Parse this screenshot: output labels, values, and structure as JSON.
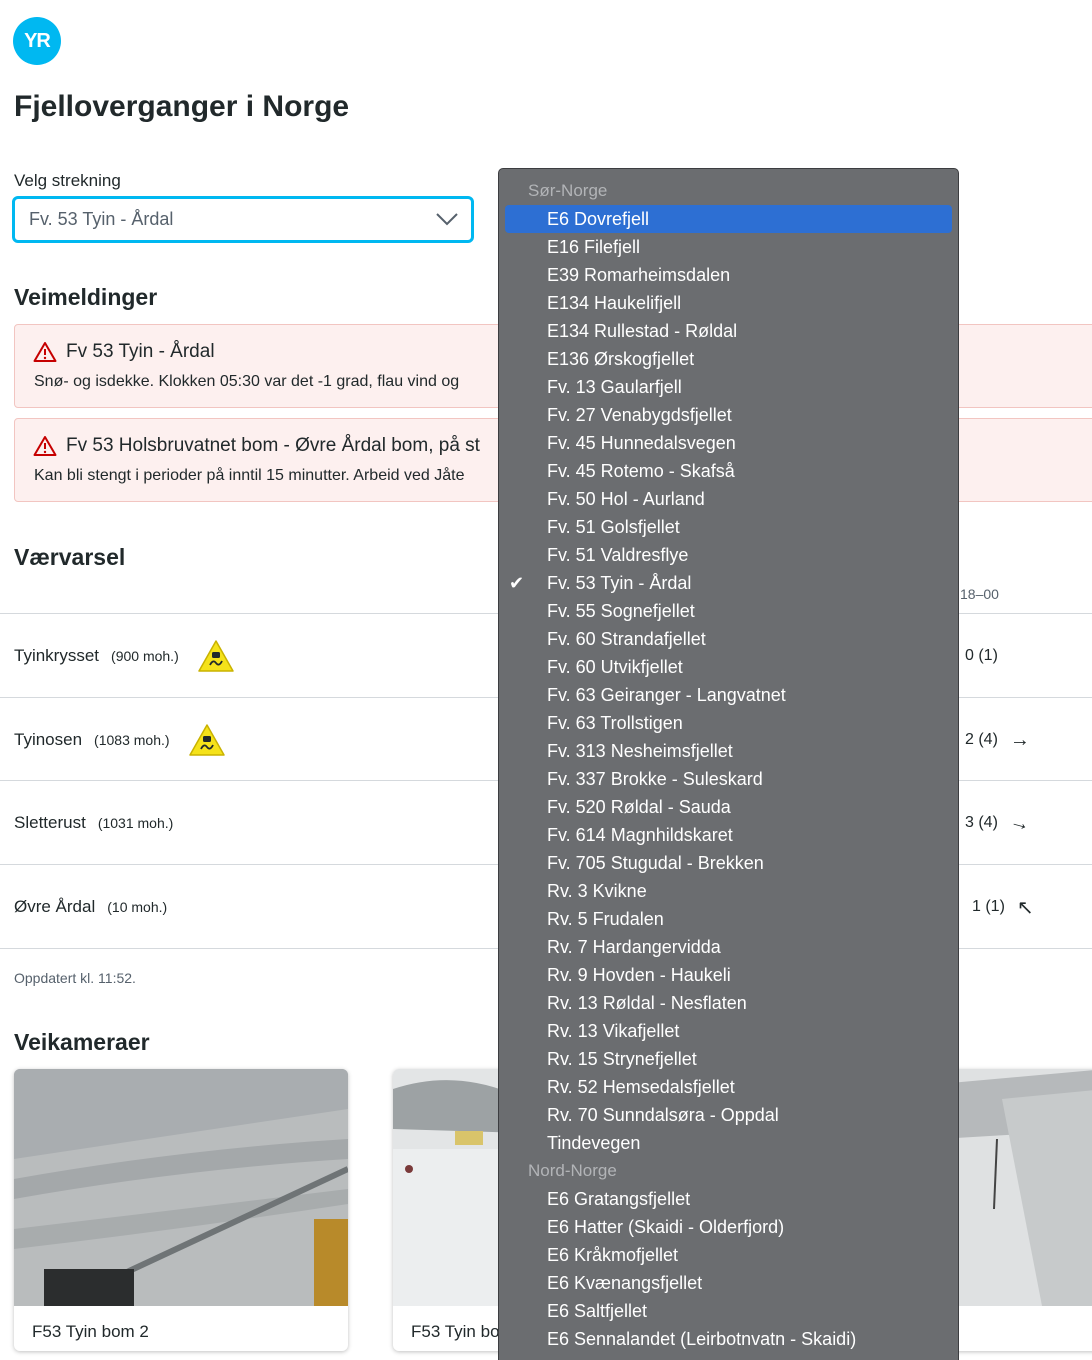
{
  "logo": {
    "text": "YR"
  },
  "page": {
    "title": "Fjelloverganger i Norge"
  },
  "select": {
    "label": "Velg strekning",
    "value": "Fv. 53 Tyin - Årdal"
  },
  "road_messages": {
    "title": "Veimeldinger",
    "items": [
      {
        "title": "Fv 53 Tyin - Årdal",
        "text": "Snø- og isdekke. Klokken 05:30 var det -1 grad, flau vind og"
      },
      {
        "title": "Fv 53 Holsbruvatnet bom - Øvre Årdal bom, på st",
        "text": "Kan bli stengt i perioder på inntil 15 minutter. Arbeid ved Jåte"
      }
    ]
  },
  "forecast": {
    "title": "Værvarsel",
    "column_header": "18–00",
    "rows": [
      {
        "name": "Tyinkrysset",
        "altitude": "(900 moh.)",
        "warning": true,
        "wind": "0 (1)",
        "arrow": ""
      },
      {
        "name": "Tyinosen",
        "altitude": "(1083 moh.)",
        "warning": true,
        "wind": "2 (4)",
        "arrow": "→"
      },
      {
        "name": "Sletterust",
        "altitude": "(1031 moh.)",
        "warning": false,
        "wind": "3 (4)",
        "arrow": "→"
      },
      {
        "name": "Øvre Årdal",
        "altitude": "(10 moh.)",
        "warning": false,
        "wind": "1 (1)",
        "arrow": "↖"
      }
    ],
    "updated": "Oppdatert kl. 11:52."
  },
  "cameras": {
    "title": "Veikameraer",
    "items": [
      {
        "label": "F53 Tyin bom 2"
      },
      {
        "label": "F53 Tyin bo"
      },
      {
        "label": ""
      }
    ]
  },
  "dropdown": {
    "groups": [
      {
        "name": "Sør-Norge",
        "items": [
          "E6 Dovrefjell",
          "E16 Filefjell",
          "E39 Romarheimsdalen",
          "E134 Haukelifjell",
          "E134 Rullestad - Røldal",
          "E136 Ørskogfjellet",
          "Fv. 13 Gaularfjell",
          "Fv. 27 Venabygdsfjellet",
          "Fv. 45 Hunnedalsvegen",
          "Fv. 45 Rotemo - Skafså",
          "Fv. 50 Hol - Aurland",
          "Fv. 51 Golsfjellet",
          "Fv. 51 Valdresflye",
          "Fv. 53 Tyin - Årdal",
          "Fv. 55 Sognefjellet",
          "Fv. 60 Strandafjellet",
          "Fv. 60 Utvikfjellet",
          "Fv. 63 Geiranger - Langvatnet",
          "Fv. 63 Trollstigen",
          "Fv. 313 Nesheimsfjellet",
          "Fv. 337 Brokke - Suleskard",
          "Fv. 520 Røldal - Sauda",
          "Fv. 614 Magnhildskaret",
          "Fv. 705 Stugudal - Brekken",
          "Rv. 3 Kvikne",
          "Rv. 5 Frudalen",
          "Rv. 7 Hardangervidda",
          "Rv. 9 Hovden - Haukeli",
          "Rv. 13 Røldal - Nesflaten",
          "Rv. 13 Vikafjellet",
          "Rv. 15 Strynefjellet",
          "Rv. 52 Hemsedalsfjellet",
          "Rv. 70 Sunndalsøra - Oppdal",
          "Tindevegen"
        ]
      },
      {
        "name": "Nord-Norge",
        "items": [
          "E6 Gratangsfjellet",
          "E6 Hatter (Skaidi - Olderfjord)",
          "E6 Kråkmofjellet",
          "E6 Kvænangsfjellet",
          "E6 Saltfjellet",
          "E6 Sennalandet (Leirbotnvatn - Skaidi)"
        ]
      }
    ],
    "highlighted": "E6 Dovrefjell",
    "selected": "Fv. 53 Tyin - Årdal"
  },
  "colors": {
    "brand": "#00b8f1",
    "highlight": "#2d6fd3",
    "alert_bg": "#fdf0ef",
    "warning_yellow": "#f5e21a"
  }
}
